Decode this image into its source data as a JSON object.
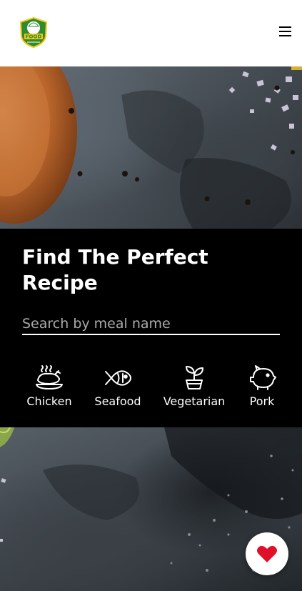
{
  "header": {
    "logo_name": "food-logo",
    "logo_text": "FOOD",
    "menu_icon": "hamburger-icon"
  },
  "hero": {
    "title": "Find The Perfect Recipe"
  },
  "search": {
    "placeholder": "Search by meal name",
    "value": ""
  },
  "categories": [
    {
      "label": "Chicken",
      "icon": "chicken-icon"
    },
    {
      "label": "Seafood",
      "icon": "fish-icon"
    },
    {
      "label": "Vegetarian",
      "icon": "plant-icon"
    },
    {
      "label": "Pork",
      "icon": "pig-icon"
    }
  ],
  "favorites": {
    "icon": "heart-icon",
    "color": "#e0102a"
  },
  "colors": {
    "panel": "#000000",
    "logo_green": "#2e8b2e",
    "logo_yellow": "#f5c518"
  }
}
